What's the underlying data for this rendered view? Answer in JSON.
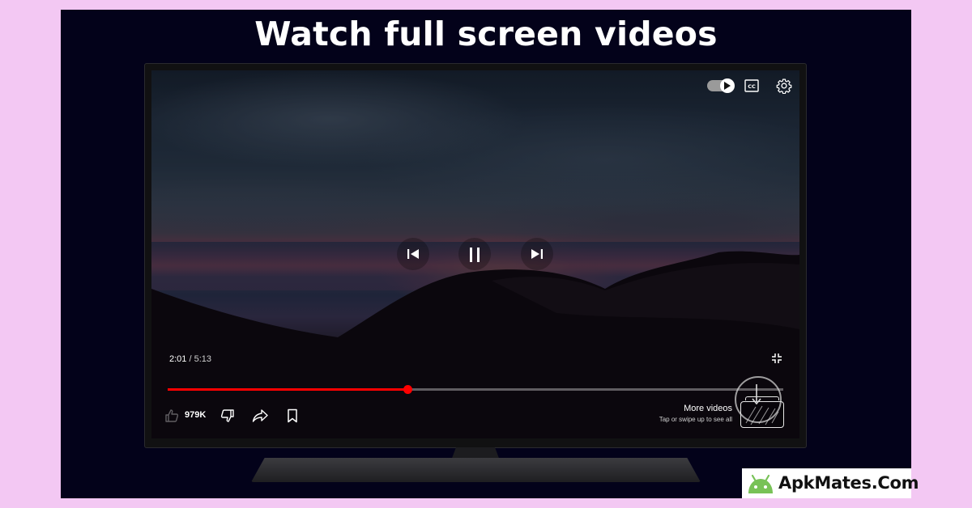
{
  "headline": "Watch full screen videos",
  "player": {
    "time_current": "2:01",
    "time_separator": "/",
    "time_duration": "5:13",
    "progress_fraction": 0.39,
    "like_count": "979K",
    "more_videos_title": "More videos",
    "more_videos_hint": "Tap or swipe up to see all",
    "progress_color": "#ff0000"
  },
  "icons": {
    "autoplay": "autoplay-toggle-icon",
    "captions": "closed-captions-icon",
    "settings": "gear-icon",
    "previous": "skip-previous-icon",
    "pause": "pause-icon",
    "next": "skip-next-icon",
    "exit_fullscreen": "exit-fullscreen-icon",
    "like": "thumbs-up-icon",
    "dislike": "thumbs-down-icon",
    "share": "share-icon",
    "save": "bookmark-icon"
  },
  "brand": {
    "name": "ApkMates.Com",
    "icon": "android-icon",
    "icon_color": "#78c257"
  },
  "colors": {
    "page_background": "#f3c8f3",
    "panel_background": "#03021a"
  }
}
